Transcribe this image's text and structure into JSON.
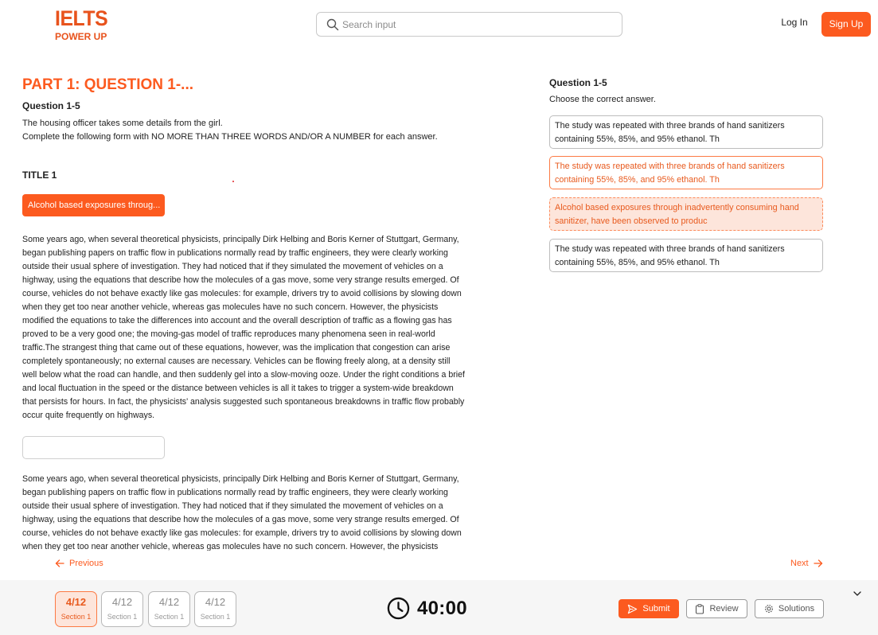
{
  "header": {
    "logo_line1": "IELTS",
    "logo_line2": "POWER UP",
    "search_placeholder": "Search input",
    "login_label": "Log In",
    "signup_label": "Sign Up"
  },
  "colors": {
    "accent": "#fc5a1f",
    "accent_soft": "#fde5db",
    "footer_bg": "#f6f6f6"
  },
  "left": {
    "part_title": "PART 1: QUESTION 1-...",
    "question_title": "Question 1-5",
    "instruction_line1": "The housing officer takes some details from the girl.",
    "instruction_line2": "Complete the following form with NO MORE THAN THREE WORDS AND/OR A NUMBER for each answer.",
    "section_title": "TITLE 1",
    "answer_pill": "Alcohol based exposures throug...",
    "passage1": "Some years ago, when several theoretical physicists, principally Dirk Helbing and Boris Kerner of Stuttgart, Germany, began publishing papers on traffic flow in publications normally read by traffic engineers, they were clearly working outside their usual sphere of investigation. They had noticed that if they simulated the movement of vehicles on a highway, using the equations that describe how the molecules of a gas move, some very strange results emerged. Of course, vehicles do not behave exactly like gas molecules: for example, drivers try to avoid collisions by slowing down when they get too near another vehicle, whereas gas molecules have no such concern. However, the physicists modified the equations to take the differences into account and the overall description of traffic as a flowing gas has proved to be a very good one; the moving-gas model of traffic reproduces many phenomena seen in real-world traffic.The strangest thing that came out of these equations, however, was the implication that congestion can arise completely spontaneously; no external causes are necessary. Vehicles can be flowing freely along, at a density still well below what the road can handle, and then suddenly gel into a slow-moving ooze. Under the right conditions a brief and local fluctuation in the speed or the distance between vehicles is all it takes to trigger a system-wide breakdown that persists for hours. In fact, the physicists' analysis suggested such spontaneous breakdowns in traffic flow probably occur quite frequently on highways.",
    "passage2": "Some years ago, when several theoretical physicists, principally Dirk Helbing and Boris Kerner of Stuttgart, Germany, began publishing papers on traffic flow in publications normally read by traffic engineers, they were clearly working outside their usual sphere of investigation. They had noticed that if they simulated the movement of vehicles on a highway, using the equations that describe how the molecules of a gas move, some very strange results emerged. Of course, vehicles do not behave exactly like gas molecules: for example, drivers try to avoid collisions by slowing down when they get too near another vehicle, whereas gas molecules have no such concern. However, the physicists modified the equations to take the differences into account and the overall description of traffic as a flowing gas has proved to be a very good one."
  },
  "right": {
    "question_title": "Question 1-5",
    "subtitle": "Choose the correct answer.",
    "options": [
      {
        "text": "The study was repeated with three brands of hand sanitizers containing 55%, 85%, and 95% ethanol. Th",
        "state": "default"
      },
      {
        "text": "The study was repeated with three brands of hand sanitizers containing 55%, 85%, and 95% ethanol. Th",
        "state": "selected"
      },
      {
        "text": "Alcohol based exposures through inadvertently consuming hand sanitizer, have been observed to produc",
        "state": "highlighted"
      },
      {
        "text": "The study was repeated with three brands of hand sanitizers containing 55%, 85%, and 95% ethanol. Th",
        "state": "default"
      }
    ]
  },
  "nav": {
    "previous_label": "Previous",
    "next_label": "Next"
  },
  "footer": {
    "sections": [
      {
        "count": "4/12",
        "label": "Section 1",
        "active": true
      },
      {
        "count": "4/12",
        "label": "Section 1",
        "active": false
      },
      {
        "count": "4/12",
        "label": "Section 1",
        "active": false
      },
      {
        "count": "4/12",
        "label": "Section 1",
        "active": false
      }
    ],
    "timer": "40:00",
    "submit_label": "Submit",
    "review_label": "Review",
    "solutions_label": "Solutions"
  }
}
